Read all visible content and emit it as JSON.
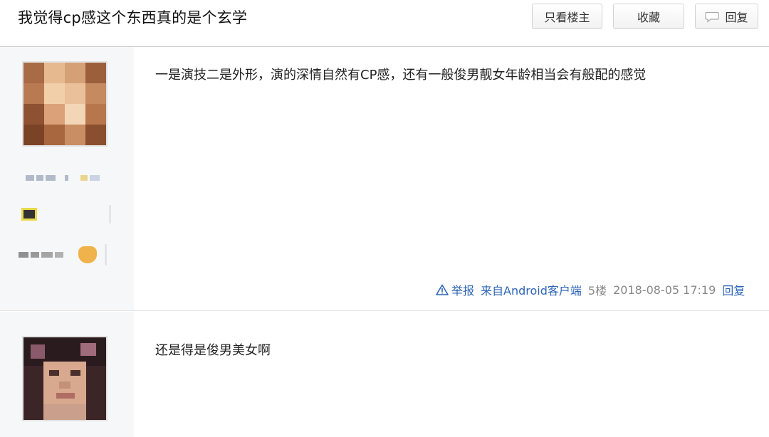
{
  "header": {
    "title": "我觉得cp感这个东西真的是个玄学",
    "buttons": {
      "only_op": "只看楼主",
      "favorite": "收藏",
      "reply": "回复"
    }
  },
  "posts": [
    {
      "content": "一是演技二是外形，演的深情自然有CP感，还有一般俊男靓女年龄相当会有般配的感觉",
      "tail": {
        "report": "举报",
        "source": "来自Android客户端",
        "floor": "5楼",
        "time": "2018-08-05 17:19",
        "reply": "回复"
      }
    },
    {
      "content": "还是得是俊男美女啊"
    }
  ],
  "colors": {
    "link": "#2d64b3",
    "sidebar_bg": "#f6f7f9"
  },
  "icons": [
    "warning-icon",
    "reply-bubble-icon"
  ]
}
